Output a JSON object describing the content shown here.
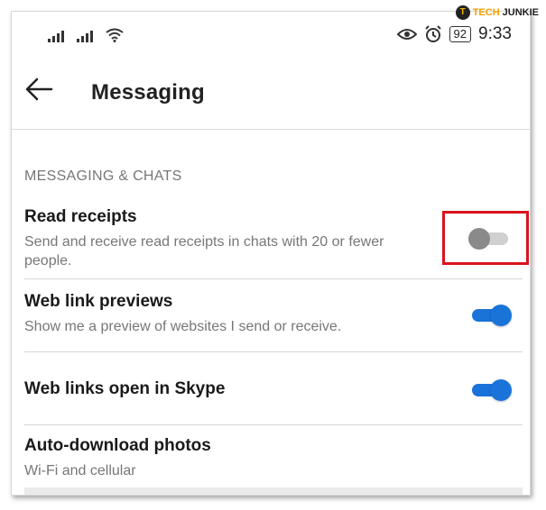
{
  "status_bar": {
    "time": "9:33",
    "battery": "92"
  },
  "watermark": {
    "logo_letter": "T",
    "tech": "TECH",
    "junkie": "JUNKIE"
  },
  "header": {
    "title": "Messaging"
  },
  "section": {
    "title": "MESSAGING & CHATS"
  },
  "settings": [
    {
      "title": "Read receipts",
      "description": "Send and receive read receipts in chats with 20 or fewer people.",
      "toggle": "off"
    },
    {
      "title": "Web link previews",
      "description": "Show me a preview of websites I send or receive.",
      "toggle": "on"
    },
    {
      "title": "Web links open in Skype",
      "description": "",
      "toggle": "on"
    },
    {
      "title": "Auto-download photos",
      "description": "Wi-Fi and cellular"
    }
  ],
  "colors": {
    "accent": "#1a73d9",
    "highlight": "#d9141f"
  }
}
